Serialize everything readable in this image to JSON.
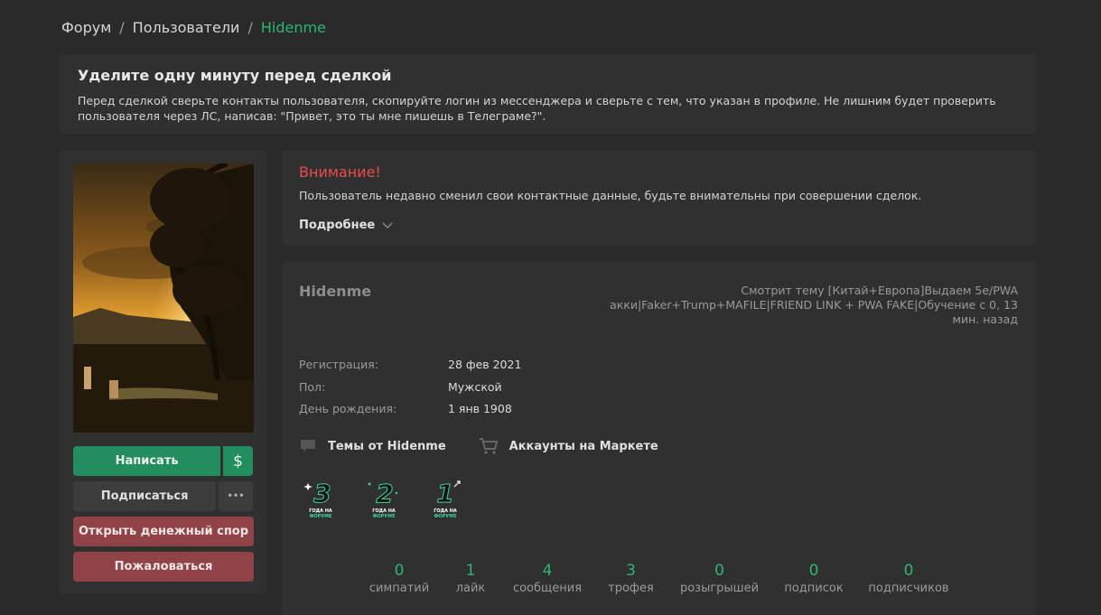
{
  "breadcrumb": {
    "items": [
      "Форум",
      "Пользователи"
    ],
    "separator": "/",
    "current": "Hidenme"
  },
  "notice": {
    "title": "Уделите одну минуту перед сделкой",
    "text": "Перед сделкой сверьте контакты пользователя, скопируйте логин из мессенджера и сверьте с тем, что указан в профиле. Не лишним будет проверить пользователя через ЛС, написав: \"Привет, это ты мне пишешь в Телеграме?\"."
  },
  "sidebar": {
    "write_label": "Написать",
    "dollar_label": "$",
    "subscribe_label": "Подписаться",
    "more_label": "•••",
    "dispute_label": "Открыть денежный спор",
    "report_label": "Пожаловаться"
  },
  "warning": {
    "title": "Внимание!",
    "text": "Пользователь недавно сменил свои контактные данные, будьте внимательны при совершении сделок.",
    "more_label": "Подробнее"
  },
  "profile": {
    "username": "Hidenme",
    "activity": "Смотрит тему [Китай+Европа]Выдаем 5e/PWA акки|Faker+Trump+MAFILE|FRIEND LINK + PWA FAKE|Обучение с 0, 13 мин. назад",
    "info": [
      {
        "label": "Регистрация:",
        "value": "28 фев 2021"
      },
      {
        "label": "Пол:",
        "value": "Мужской"
      },
      {
        "label": "День рождения:",
        "value": "1 янв 1908"
      }
    ],
    "links": {
      "topics_label": "Темы от Hidenme",
      "market_label": "Аккаунты на Маркете"
    },
    "trophies": [
      {
        "number": "3",
        "caption1": "ГОДА НА",
        "caption2": "ФОРУМЕ"
      },
      {
        "number": "2",
        "caption1": "ГОДА НА",
        "caption2": "ФОРУМЕ"
      },
      {
        "number": "1",
        "caption1": "ГОДА НА",
        "caption2": "ФОРУМЕ"
      }
    ],
    "stats": [
      {
        "value": "0",
        "label": "симпатий"
      },
      {
        "value": "1",
        "label": "лайк"
      },
      {
        "value": "4",
        "label": "сообщения"
      },
      {
        "value": "3",
        "label": "трофея"
      },
      {
        "value": "0",
        "label": "розыгрышей"
      },
      {
        "value": "0",
        "label": "подписок"
      },
      {
        "value": "0",
        "label": "подписчиков"
      }
    ]
  },
  "colors": {
    "accent": "#2bb673",
    "warning": "#ee4b4b",
    "background": "#2a2a2a",
    "panel": "#303030"
  }
}
